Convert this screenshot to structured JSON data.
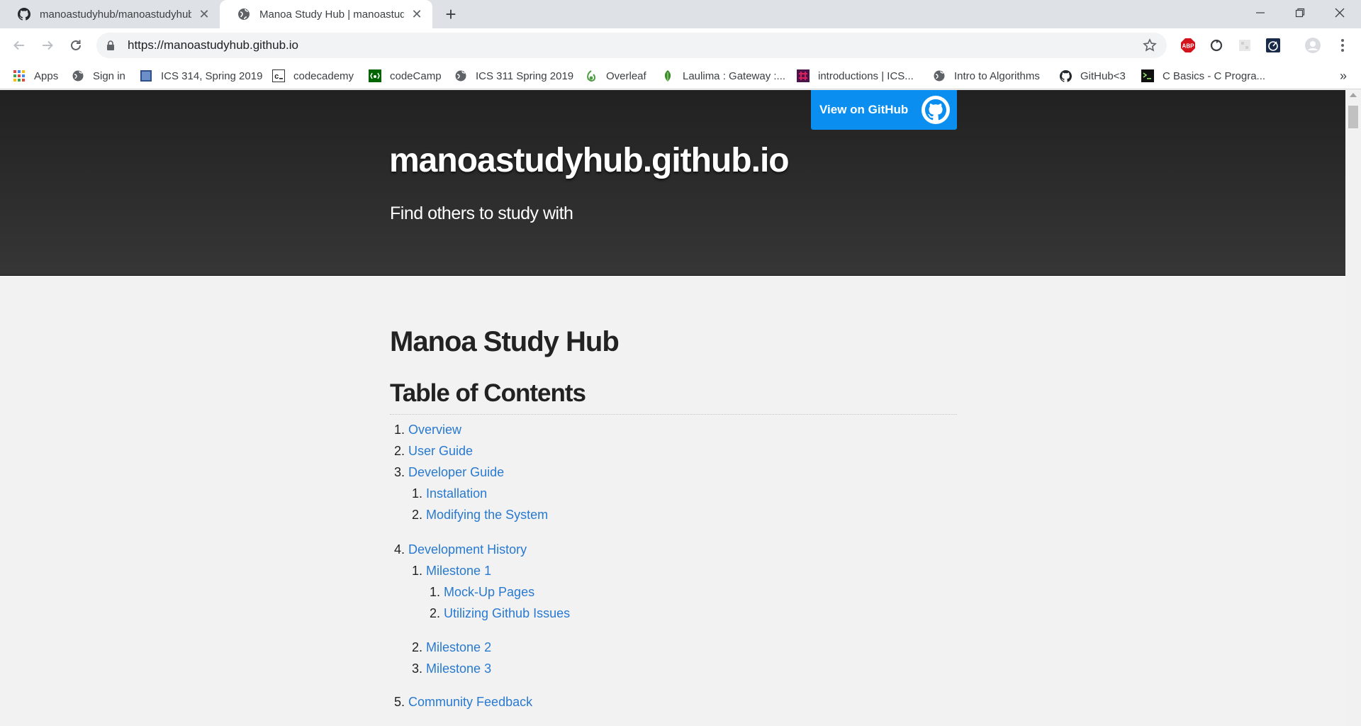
{
  "browser": {
    "tabs": [
      {
        "title": "manoastudyhub/manoastudyhub",
        "icon": "github-icon"
      },
      {
        "title": "Manoa Study Hub | manoastudyhub",
        "icon": "globe-icon"
      }
    ],
    "new_tab_label": "+",
    "url": "https://manoastudyhub.github.io"
  },
  "bookmarks": [
    {
      "label": "Apps",
      "icon": "apps-grid-icon"
    },
    {
      "label": "Sign in",
      "icon": "globe-icon"
    },
    {
      "label": "ICS 314, Spring 2019",
      "icon": "page-icon"
    },
    {
      "label": "codecademy",
      "icon": "codecademy-icon"
    },
    {
      "label": "codeCamp",
      "icon": "freecodecamp-icon"
    },
    {
      "label": "ICS 311 Spring 2019",
      "icon": "globe-icon"
    },
    {
      "label": "Overleaf",
      "icon": "overleaf-icon"
    },
    {
      "label": "Laulima : Gateway :...",
      "icon": "laulima-icon"
    },
    {
      "label": "introductions | ICS...",
      "icon": "slack-icon"
    },
    {
      "label": "Intro to Algorithms",
      "icon": "globe-icon"
    },
    {
      "label": "GitHub<3",
      "icon": "github-icon"
    },
    {
      "label": "C Basics - C Progra...",
      "icon": "terminal-icon"
    }
  ],
  "bookmarks_more": "»",
  "extensions": {
    "adblock_label": "ABP"
  },
  "page": {
    "view_on_github": "View on GitHub",
    "site_title": "manoastudyhub.github.io",
    "site_subtitle": "Find others to study with",
    "h1": "Manoa Study Hub",
    "h2": "Table of Contents",
    "toc": [
      {
        "num": "1.",
        "label": "Overview"
      },
      {
        "num": "2.",
        "label": "User Guide"
      },
      {
        "num": "3.",
        "label": "Developer Guide"
      },
      {
        "num": "1.",
        "label": "Installation"
      },
      {
        "num": "2.",
        "label": "Modifying the System"
      },
      {
        "num": "4.",
        "label": "Development History"
      },
      {
        "num": "1.",
        "label": "Milestone 1"
      },
      {
        "num": "1.",
        "label": "Mock-Up Pages"
      },
      {
        "num": "2.",
        "label": "Utilizing Github Issues"
      },
      {
        "num": "2.",
        "label": "Milestone 2"
      },
      {
        "num": "3.",
        "label": "Milestone 3"
      },
      {
        "num": "5.",
        "label": "Community Feedback"
      }
    ]
  },
  "colors": {
    "link": "#2879d0",
    "header_bg": "#2b2b2b",
    "github_button": "#0a8ff0",
    "page_bg": "#f2f2f2"
  }
}
